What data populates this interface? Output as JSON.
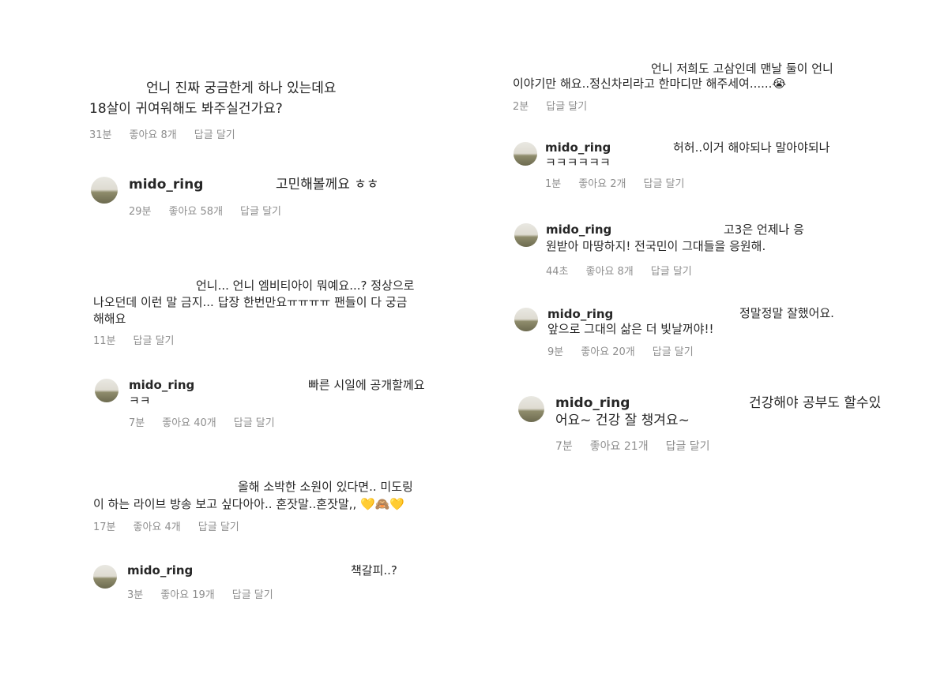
{
  "left": {
    "c1": {
      "line1": "언니 진짜 궁금한게 하나 있는데요",
      "line2": "18살이 귀여워해도 봐주실건가요?",
      "time": "31분",
      "likes": "좋아요 8개",
      "reply": "답글 달기"
    },
    "r1": {
      "username": "mido_ring",
      "text": "고민해볼께요 ㅎㅎ",
      "time": "29분",
      "likes": "좋아요 58개",
      "reply": "답글 달기"
    },
    "c2": {
      "line1": "언니... 언니 엠비티아이 뭐예요...? 정상으로",
      "line2": "나오던데 이런 말 금지... 답장 한번만요ㅠㅠㅠㅠ 팬들이 다 궁금",
      "line3": "해해요",
      "time": "11분",
      "reply": "답글 달기"
    },
    "r2": {
      "username": "mido_ring",
      "text": "빠른 시일에 공개할께요",
      "text2": "ㅋㅋ",
      "time": "7분",
      "likes": "좋아요 40개",
      "reply": "답글 달기"
    },
    "c3": {
      "line1": "올해 소박한 소원이 있다면.. 미도링",
      "line2": "이 하는 라이브 방송 보고 싶다아아.. 혼잣말..혼잣말,, 💛🙈💛",
      "time": "17분",
      "likes": "좋아요 4개",
      "reply": "답글 달기"
    },
    "r3": {
      "username": "mido_ring",
      "text": "책갈피..?",
      "time": "3분",
      "likes": "좋아요 19개",
      "reply": "답글 달기"
    }
  },
  "right": {
    "c4": {
      "line1": "언니 저희도 고삼인데 맨날 둘이 언니",
      "line2": "이야기만 해요..정신차리라고 한마디만 해주세여......😭",
      "time": "2분",
      "reply": "답글 달기"
    },
    "r4": {
      "username": "mido_ring",
      "text": "허허..이거 해야되나 말아야되나",
      "text2": "ㅋㅋㅋㅋㅋㅋ",
      "time": "1분",
      "likes": "좋아요 2개",
      "reply": "답글 달기"
    },
    "r5": {
      "username": "mido_ring",
      "text": "고3은 언제나 응",
      "text2": "원받아 마땅하지! 전국민이 그대들을 응원해.",
      "time": "44초",
      "likes": "좋아요 8개",
      "reply": "답글 달기"
    },
    "r6": {
      "username": "mido_ring",
      "text": "정말정말 잘했어요.",
      "text2": "앞으로 그대의 삶은 더 빛날꺼야!!",
      "time": "9분",
      "likes": "좋아요 20개",
      "reply": "답글 달기"
    },
    "r7": {
      "username": "mido_ring",
      "text": "건강해야 공부도 할수있",
      "text2": "어요~ 건강 잘 챙겨요~",
      "time": "7분",
      "likes": "좋아요 21개",
      "reply": "답글 달기"
    }
  }
}
